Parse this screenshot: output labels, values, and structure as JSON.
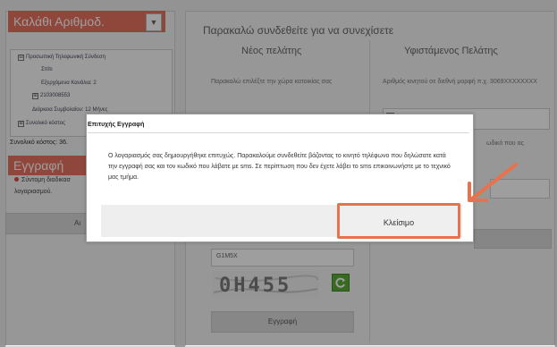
{
  "left_panel": {
    "cart_title": "Καλάθι Αριθμοδ.",
    "dropdown_glyph": "▼",
    "tree": [
      {
        "toggle": "⊟",
        "label": "Προσωπική Τηλεφωνική Σύνδεση"
      },
      {
        "toggle": "",
        "label": "Σπίτι"
      },
      {
        "toggle": "",
        "label": "Εξερχόμενα Κανάλια: 2"
      },
      {
        "toggle": "⊞",
        "label": "2103008553"
      },
      {
        "toggle": "",
        "label": "Διάρκεια Συμβολαίου: 12 Μήνες"
      },
      {
        "toggle": "⊞",
        "label": "Συνολικό κόστος"
      }
    ],
    "total_prefix": "Συνολικό κόστος: 36.",
    "register_title": "Εγγραφή",
    "note_line1": "Σύντομη διαδικασ",
    "note_line2": "λογαριασμού.",
    "button_partial": "Αι"
  },
  "right_panel": {
    "login_prompt": "Παρακαλώ συνδεθείτε για να συνεχίσετε",
    "new_customer": "Νέος πελάτης",
    "existing_customer": "Υφιστάμενος Πελάτης",
    "country_prompt": "Παρακαλώ επιλέξτε την χώρα κατοικίας σας",
    "mobile_hint": "Αριθμός κινητού σε διεθνή μορφή π.χ. 3069XXXXXXXX",
    "partial_text": "ωδικό που ας",
    "captcha_code": "G1M5X",
    "captcha_image_text": "0H455",
    "register_button": "Εγγραφή"
  },
  "dialog": {
    "title": "Επιτυχής Εγγραφή",
    "body": "Ο λογαριασμός σας δημιουργήθηκε επιτυχώς. Παρακαλούμε συνδεθείτε βάζοντας το κινητό τηλέφωνο που δηλώσατε κατά την εγγραφή σας και τον κωδικό που λάβατε με sms. Σε περίπτωση που δεν έχετε λάβει το sms επικοινωνήστε με το τεχνικό μας τμήμα.",
    "close_button": "Κλείσιμο"
  },
  "colors": {
    "accent_header": "#e7735f",
    "annotation": "#e9724e",
    "refresh_green": "#5cab3b"
  },
  "icons": {
    "dropdown": "chevron-down-icon",
    "refresh": "refresh-icon",
    "note_bullet": "bullet-icon",
    "annotation": "arrow-icon"
  }
}
